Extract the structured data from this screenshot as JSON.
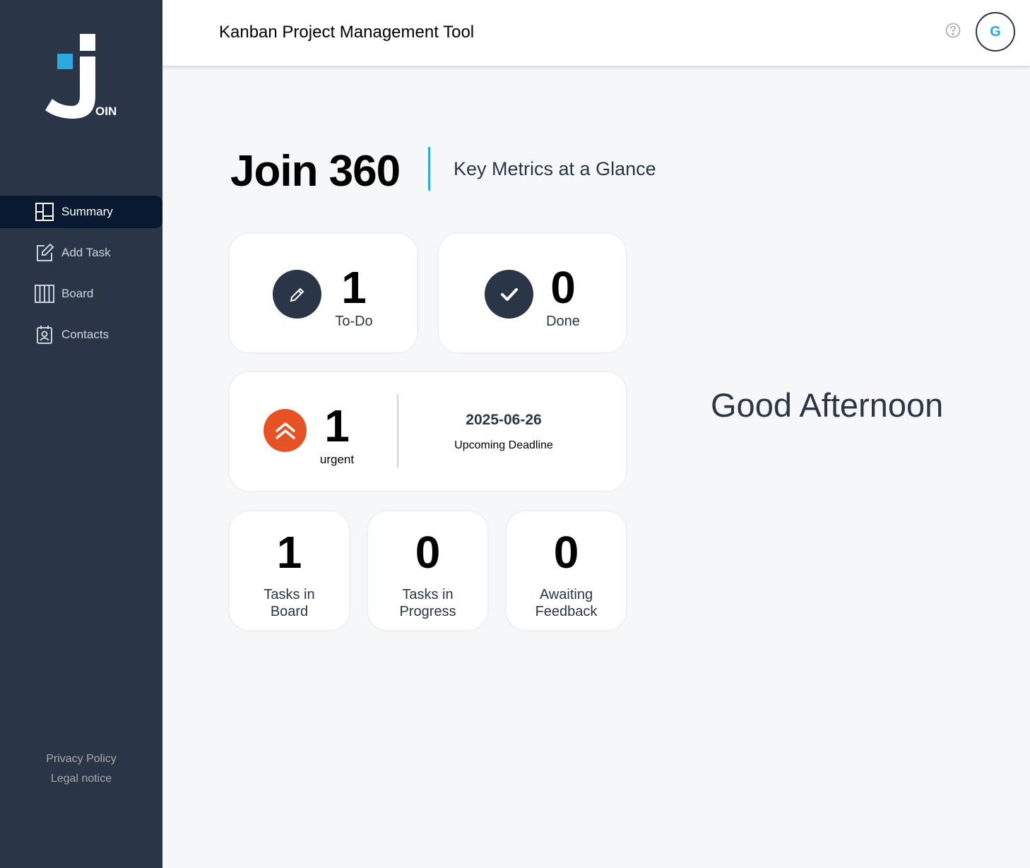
{
  "app": {
    "title": "Kanban Project Management Tool",
    "logo_text": "OIN"
  },
  "header": {
    "help_icon": "question-circle-icon",
    "avatar_initial": "G"
  },
  "sidebar": {
    "items": [
      {
        "label": "Summary",
        "icon": "summary-icon",
        "active": true
      },
      {
        "label": "Add Task",
        "icon": "edit-square-icon",
        "active": false
      },
      {
        "label": "Board",
        "icon": "board-columns-icon",
        "active": false
      },
      {
        "label": "Contacts",
        "icon": "contact-badge-icon",
        "active": false
      }
    ],
    "footer": {
      "privacy": "Privacy Policy",
      "legal": "Legal notice"
    }
  },
  "main": {
    "title": "Join 360",
    "subtitle": "Key Metrics at a Glance",
    "todo": {
      "count": "1",
      "label": "To-Do",
      "icon": "pencil-icon"
    },
    "done": {
      "count": "0",
      "label": "Done",
      "icon": "check-icon"
    },
    "urgent": {
      "count": "1",
      "label": "urgent",
      "icon": "double-chevron-up-icon"
    },
    "deadline": {
      "date": "2025-06-26",
      "label": "Upcoming Deadline"
    },
    "stats": [
      {
        "count": "1",
        "label_line1": "Tasks in",
        "label_line2": "Board"
      },
      {
        "count": "0",
        "label_line1": "Tasks in",
        "label_line2": "Progress"
      },
      {
        "count": "0",
        "label_line1": "Awaiting",
        "label_line2": "Feedback"
      }
    ],
    "greeting": "Good Afternoon"
  },
  "colors": {
    "sidebar_bg": "#2a3647",
    "active_nav": "#091931",
    "accent_blue": "#29abe2",
    "urgent_orange": "#e65224",
    "dark_circle": "#2a3647"
  }
}
